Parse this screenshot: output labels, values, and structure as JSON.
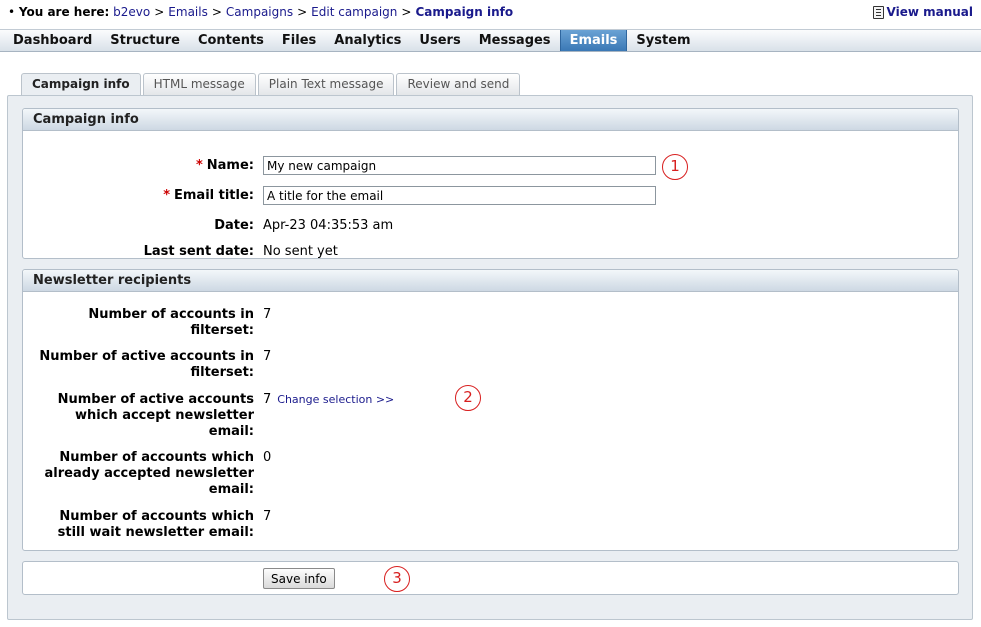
{
  "breadcrumb": {
    "prefix": "You are here:",
    "items": [
      "b2evo",
      "Emails",
      "Campaigns",
      "Edit campaign"
    ],
    "current": "Campaign info",
    "separator": ">"
  },
  "help": {
    "view_manual": "View manual"
  },
  "menu": {
    "items": [
      "Dashboard",
      "Structure",
      "Contents",
      "Files",
      "Analytics",
      "Users",
      "Messages",
      "Emails",
      "System"
    ],
    "active": "Emails"
  },
  "tabs": [
    "Campaign info",
    "HTML message",
    "Plain Text message",
    "Review and send"
  ],
  "campaign_info": {
    "title": "Campaign info",
    "required_mark": "*",
    "name_label": "Name:",
    "name_value": "My new campaign",
    "email_title_label": "Email title:",
    "email_title_value": "A title for the email",
    "date_label": "Date:",
    "date_value": "Apr-23 04:35:53 am",
    "last_sent_label": "Last sent date:",
    "last_sent_value": "No sent yet"
  },
  "recipients": {
    "title": "Newsletter recipients",
    "rows": [
      {
        "label_1": "Number of accounts in",
        "label_2": "filterset:",
        "value": "7"
      },
      {
        "label_1": "Number of active accounts in",
        "label_2": "filterset:",
        "value": "7"
      },
      {
        "label_1": "Number of active accounts",
        "label_2": "which accept newsletter",
        "label_3": "email:",
        "value": "7"
      },
      {
        "label_1": "Number of accounts which",
        "label_2": "already accepted newsletter",
        "label_3": "email:",
        "value": "0"
      },
      {
        "label_1": "Number of accounts which",
        "label_2": "still wait newsletter email:",
        "value": "7"
      }
    ],
    "change_selection": "Change selection >>"
  },
  "save_button": "Save info",
  "callouts": [
    "1",
    "2",
    "3"
  ],
  "colors": {
    "active_menu": "#3a78b5",
    "callout": "#d81f1f",
    "required": "#cc0000",
    "link": "#1a1a8c"
  }
}
